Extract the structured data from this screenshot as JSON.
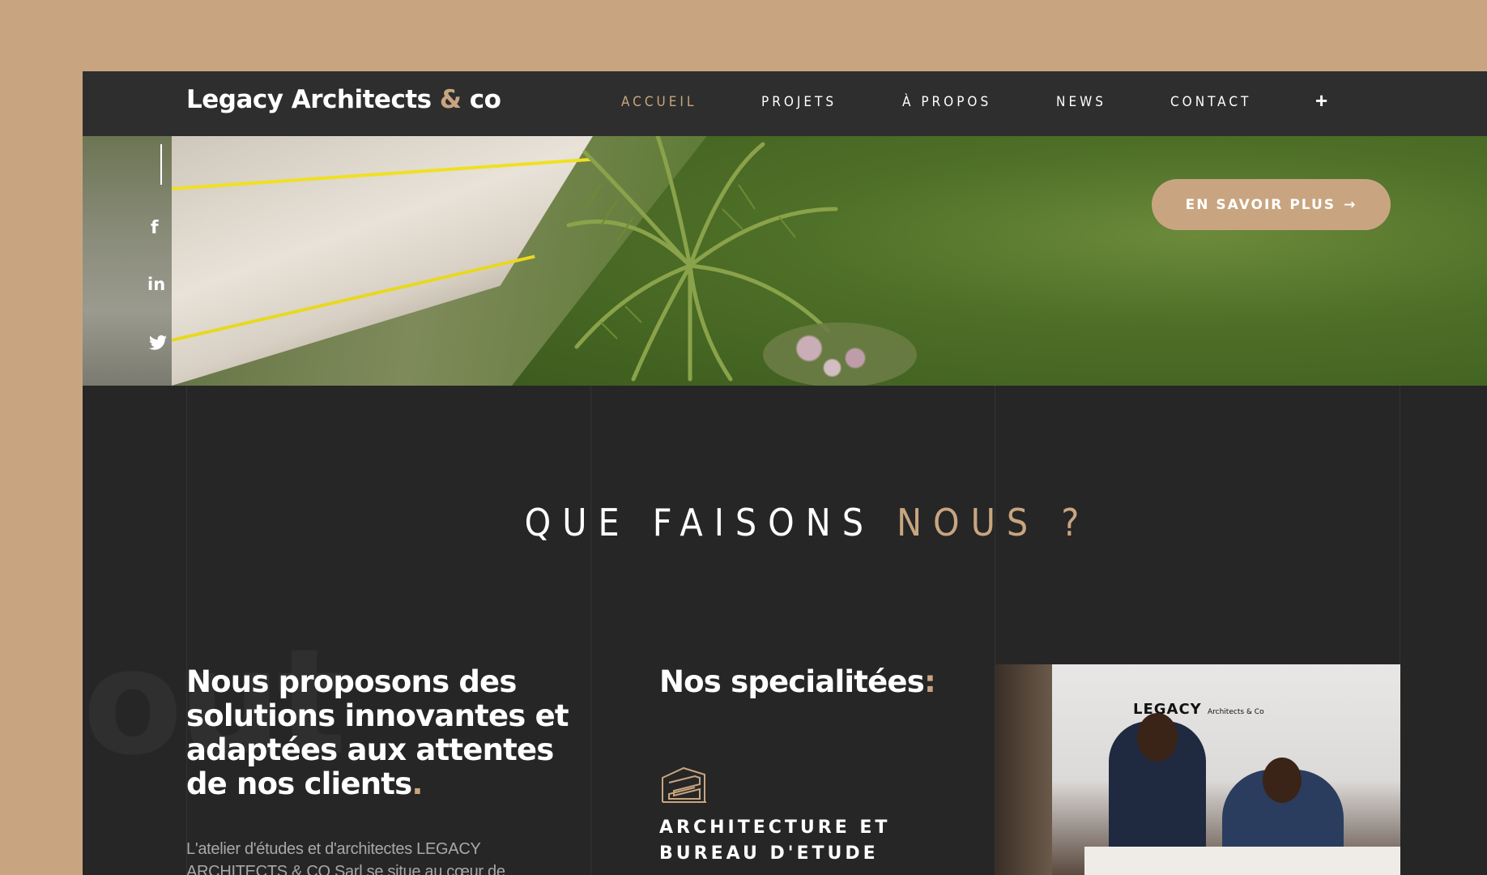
{
  "header": {
    "logo_main": "Legacy Architects ",
    "logo_amp": "&",
    "logo_end": " co",
    "nav": [
      {
        "label": "ACCUEIL",
        "active": true
      },
      {
        "label": "PROJETS",
        "active": false
      },
      {
        "label": "À PROPOS",
        "active": false
      },
      {
        "label": "NEWS",
        "active": false
      },
      {
        "label": "CONTACT",
        "active": false
      }
    ],
    "plus_symbol": "+"
  },
  "hero": {
    "cta_label": "EN SAVOIR PLUS",
    "cta_arrow": "→",
    "social": [
      {
        "icon": "facebook-icon",
        "glyph": "f"
      },
      {
        "icon": "linkedin-icon",
        "glyph": "in"
      },
      {
        "icon": "twitter-icon",
        "glyph": "🐦"
      }
    ]
  },
  "section": {
    "title_main": "QUE FAISONS ",
    "title_accent": "NOUS ?",
    "background_word": "out"
  },
  "intro": {
    "heading": "Nous proposons des solutions innovantes et adaptées aux attentes de nos clients",
    "heading_end": ".",
    "paragraph": "L'atelier d'études et d'architectes LEGACY ARCHITECTS & CO Sarl se situe au cœur de"
  },
  "specialties": {
    "heading": "Nos specialitées",
    "heading_end": ":",
    "items": [
      {
        "label": "ARCHITECTURE ET BUREAU D'ETUDE",
        "icon": "building-icon"
      }
    ]
  },
  "photo": {
    "sign_text": "LEGACY",
    "sign_sub": "Architects & Co"
  },
  "colors": {
    "accent": "#c8a580",
    "background": "#262626",
    "header": "#2e2e2e"
  }
}
